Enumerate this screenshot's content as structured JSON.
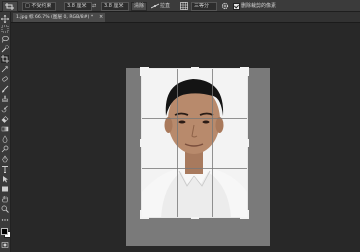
{
  "options_bar": {
    "ratio_select": "□ 不受约束",
    "width_value": "3.8 厘米",
    "swap_symbol": "⇄",
    "height_value": "3.8 厘米",
    "clear_button": "清除",
    "straighten_label": "拉直",
    "view_select": "三等分",
    "delete_pixels_label": "删除裁剪的像素"
  },
  "document_tab": {
    "title": "1.jpg 标 66.7% (图层 0, RGB/8#) *",
    "close_symbol": "×"
  },
  "tools": [
    "move-tool",
    "marquee-tool",
    "lasso-tool",
    "quick-select-tool",
    "crop-tool",
    "eyedropper-tool",
    "healing-brush-tool",
    "brush-tool",
    "clone-stamp-tool",
    "history-brush-tool",
    "eraser-tool",
    "gradient-tool",
    "blur-tool",
    "dodge-tool",
    "pen-tool",
    "type-tool",
    "path-select-tool",
    "rectangle-tool",
    "hand-tool",
    "zoom-tool"
  ],
  "colors": {
    "foreground": "#000000",
    "background": "#ffffff",
    "workspace": "#282828",
    "panel": "#3a3a3a"
  },
  "crop_overlay": "rule-of-thirds"
}
